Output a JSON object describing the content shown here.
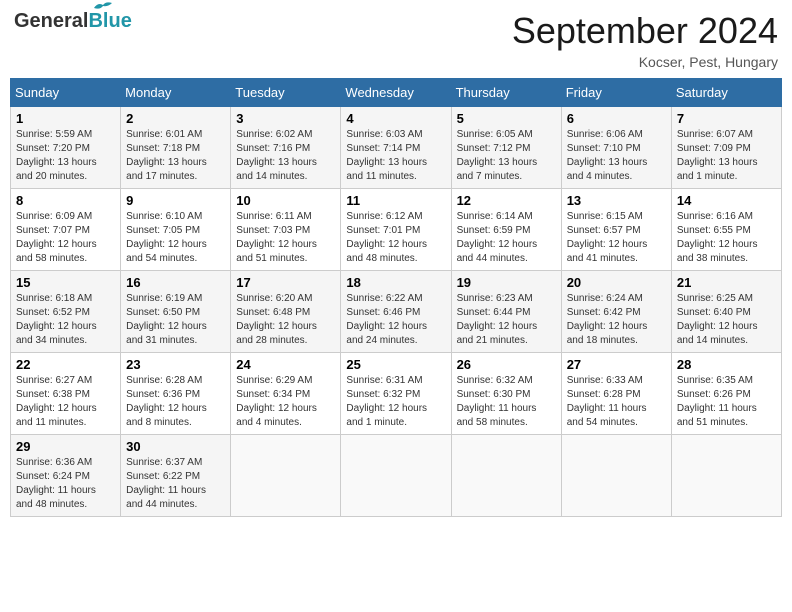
{
  "header": {
    "logo": {
      "general": "General",
      "blue": "Blue"
    },
    "month": "September 2024",
    "location": "Kocser, Pest, Hungary"
  },
  "weekdays": [
    "Sunday",
    "Monday",
    "Tuesday",
    "Wednesday",
    "Thursday",
    "Friday",
    "Saturday"
  ],
  "weeks": [
    [
      {
        "day": "1",
        "sunrise": "5:59 AM",
        "sunset": "7:20 PM",
        "daylight": "13 hours and 20 minutes."
      },
      {
        "day": "2",
        "sunrise": "6:01 AM",
        "sunset": "7:18 PM",
        "daylight": "13 hours and 17 minutes."
      },
      {
        "day": "3",
        "sunrise": "6:02 AM",
        "sunset": "7:16 PM",
        "daylight": "13 hours and 14 minutes."
      },
      {
        "day": "4",
        "sunrise": "6:03 AM",
        "sunset": "7:14 PM",
        "daylight": "13 hours and 11 minutes."
      },
      {
        "day": "5",
        "sunrise": "6:05 AM",
        "sunset": "7:12 PM",
        "daylight": "13 hours and 7 minutes."
      },
      {
        "day": "6",
        "sunrise": "6:06 AM",
        "sunset": "7:10 PM",
        "daylight": "13 hours and 4 minutes."
      },
      {
        "day": "7",
        "sunrise": "6:07 AM",
        "sunset": "7:09 PM",
        "daylight": "13 hours and 1 minute."
      }
    ],
    [
      {
        "day": "8",
        "sunrise": "6:09 AM",
        "sunset": "7:07 PM",
        "daylight": "12 hours and 58 minutes."
      },
      {
        "day": "9",
        "sunrise": "6:10 AM",
        "sunset": "7:05 PM",
        "daylight": "12 hours and 54 minutes."
      },
      {
        "day": "10",
        "sunrise": "6:11 AM",
        "sunset": "7:03 PM",
        "daylight": "12 hours and 51 minutes."
      },
      {
        "day": "11",
        "sunrise": "6:12 AM",
        "sunset": "7:01 PM",
        "daylight": "12 hours and 48 minutes."
      },
      {
        "day": "12",
        "sunrise": "6:14 AM",
        "sunset": "6:59 PM",
        "daylight": "12 hours and 44 minutes."
      },
      {
        "day": "13",
        "sunrise": "6:15 AM",
        "sunset": "6:57 PM",
        "daylight": "12 hours and 41 minutes."
      },
      {
        "day": "14",
        "sunrise": "6:16 AM",
        "sunset": "6:55 PM",
        "daylight": "12 hours and 38 minutes."
      }
    ],
    [
      {
        "day": "15",
        "sunrise": "6:18 AM",
        "sunset": "6:52 PM",
        "daylight": "12 hours and 34 minutes."
      },
      {
        "day": "16",
        "sunrise": "6:19 AM",
        "sunset": "6:50 PM",
        "daylight": "12 hours and 31 minutes."
      },
      {
        "day": "17",
        "sunrise": "6:20 AM",
        "sunset": "6:48 PM",
        "daylight": "12 hours and 28 minutes."
      },
      {
        "day": "18",
        "sunrise": "6:22 AM",
        "sunset": "6:46 PM",
        "daylight": "12 hours and 24 minutes."
      },
      {
        "day": "19",
        "sunrise": "6:23 AM",
        "sunset": "6:44 PM",
        "daylight": "12 hours and 21 minutes."
      },
      {
        "day": "20",
        "sunrise": "6:24 AM",
        "sunset": "6:42 PM",
        "daylight": "12 hours and 18 minutes."
      },
      {
        "day": "21",
        "sunrise": "6:25 AM",
        "sunset": "6:40 PM",
        "daylight": "12 hours and 14 minutes."
      }
    ],
    [
      {
        "day": "22",
        "sunrise": "6:27 AM",
        "sunset": "6:38 PM",
        "daylight": "12 hours and 11 minutes."
      },
      {
        "day": "23",
        "sunrise": "6:28 AM",
        "sunset": "6:36 PM",
        "daylight": "12 hours and 8 minutes."
      },
      {
        "day": "24",
        "sunrise": "6:29 AM",
        "sunset": "6:34 PM",
        "daylight": "12 hours and 4 minutes."
      },
      {
        "day": "25",
        "sunrise": "6:31 AM",
        "sunset": "6:32 PM",
        "daylight": "12 hours and 1 minute."
      },
      {
        "day": "26",
        "sunrise": "6:32 AM",
        "sunset": "6:30 PM",
        "daylight": "11 hours and 58 minutes."
      },
      {
        "day": "27",
        "sunrise": "6:33 AM",
        "sunset": "6:28 PM",
        "daylight": "11 hours and 54 minutes."
      },
      {
        "day": "28",
        "sunrise": "6:35 AM",
        "sunset": "6:26 PM",
        "daylight": "11 hours and 51 minutes."
      }
    ],
    [
      {
        "day": "29",
        "sunrise": "6:36 AM",
        "sunset": "6:24 PM",
        "daylight": "11 hours and 48 minutes."
      },
      {
        "day": "30",
        "sunrise": "6:37 AM",
        "sunset": "6:22 PM",
        "daylight": "11 hours and 44 minutes."
      },
      null,
      null,
      null,
      null,
      null
    ]
  ],
  "labels": {
    "sunrise": "Sunrise:",
    "sunset": "Sunset:",
    "daylight": "Daylight:"
  }
}
